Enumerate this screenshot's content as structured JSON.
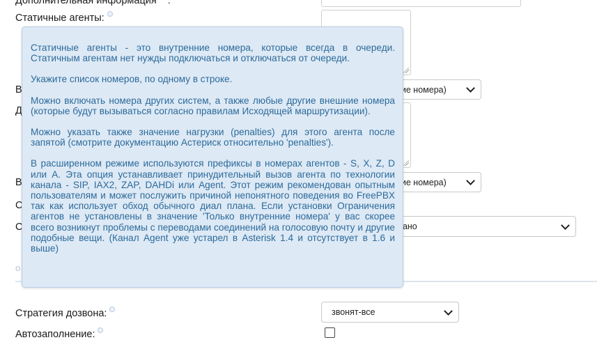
{
  "form": {
    "additional_info_label": "Дополнительная информация",
    "static_agents_label": "Статичные агенты:",
    "strategy_label": "Стратегия дозвона:",
    "autofill_label": "Автозаполнение:",
    "partial_labels": [
      "В",
      "Д",
      "В",
      "С",
      "С"
    ],
    "select_agents_1": "ние номера)",
    "select_agents_2": "ние номера)",
    "select_wide": "рано",
    "section_partial": "о",
    "strategy_value": "звонят-все"
  },
  "tooltip": {
    "paragraphs": [
      "Статичные агенты - это внутренние номера, которые всегда в очереди. Статичным агентам нет нужды подключаться и отключаться от очереди.",
      "Укажите список номеров, по одному в строке.",
      "Можно включать номера других систем, а также любые другие внешние номера (которые будут вызываться согласно правилам Исходящей маршрутизации).",
      "Можно указать также значение нагрузки (penalties) для этого агента после запятой (смотрите документацию Астериск относительно 'penalties').",
      "В расширенном режиме используются префиксы в номерах агентов - S, X, Z, D или A. Эта опция устанавливает принудительный вызов агента по технологии канала - SIP, IAX2, ZAP, DAHDi или Agent. Этот режим рекомендован опытным пользователям и может послужить причиной непонятного поведения во FreePBX так как использует обход обычного диал плана. Если установки Ограничения агентов не установлены в значение 'Только внутренние номера' у вас скорее всего возникнут проблемы с переводами соединений на голосовую почту и другие подобные вещи. (Канал Agent уже устарел в Asterisk 1.4 и отсутствует в 1.6 и выше)"
    ]
  }
}
